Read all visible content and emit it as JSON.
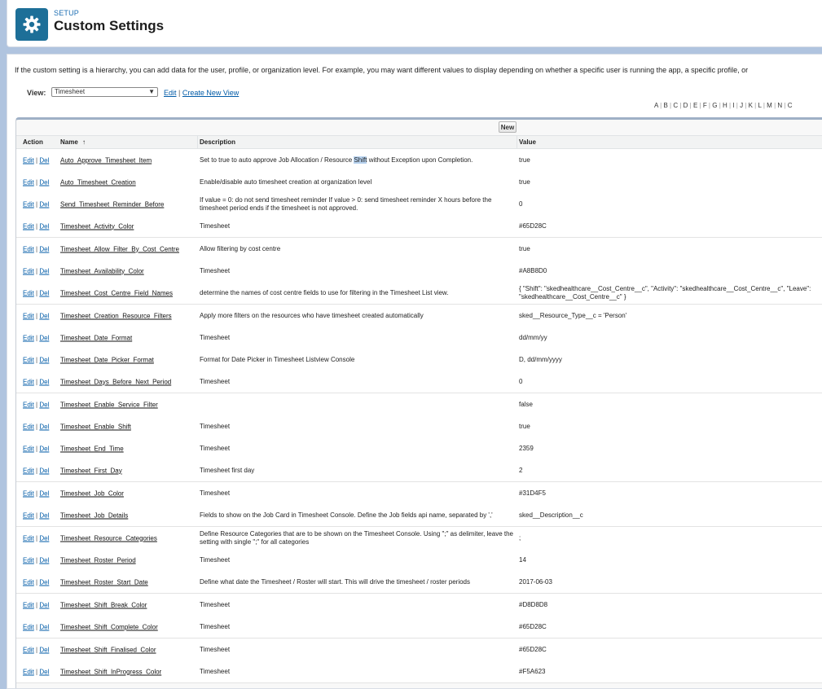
{
  "header": {
    "kicker": "SETUP",
    "title": "Custom Settings",
    "icon": "gear-icon"
  },
  "intro": "If the custom setting is a hierarchy, you can add data for the user, profile, or organization level. For example, you may want different values to display depending on whether a specific user is running the app, a specific profile, or",
  "view": {
    "label": "View:",
    "selected": "Timesheet",
    "edit_link": "Edit",
    "separator": "|",
    "create_link": "Create New View"
  },
  "alpha_filter": [
    "A",
    "B",
    "C",
    "D",
    "E",
    "F",
    "G",
    "H",
    "I",
    "J",
    "K",
    "L",
    "M",
    "N",
    "C"
  ],
  "table": {
    "new_button": "New",
    "columns": {
      "action": "Action",
      "name": "Name",
      "sort_indicator": "↑",
      "description": "Description",
      "value": "Value"
    },
    "action_edit": "Edit",
    "action_sep": "|",
    "action_del": "Del",
    "rows": [
      {
        "name": "Auto_Approve_Timesheet_Item",
        "desc_pre": "Set to true to auto approve Job Allocation / Resource ",
        "desc_hl": "Shift",
        "desc_post": " without Exception upon Completion.",
        "value": "true"
      },
      {
        "name": "Auto_Timesheet_Creation",
        "desc_pre": "Enable/disable auto timesheet creation at organization level",
        "desc_hl": "",
        "desc_post": "",
        "value": "true"
      },
      {
        "name": "Send_Timesheet_Reminder_Before",
        "desc_pre": "If value = 0: do not send timesheet reminder If value > 0: send timesheet reminder X hours before the timesheet period ends if the timesheet is not approved.",
        "desc_hl": "",
        "desc_post": "",
        "value": "0"
      },
      {
        "name": "Timesheet_Activity_Color",
        "desc_pre": "Timesheet",
        "desc_hl": "",
        "desc_post": "",
        "value": "#65D28C"
      },
      {
        "name": "Timesheet_Allow_Filter_By_Cost_Centre",
        "desc_pre": "Allow filtering by cost centre",
        "desc_hl": "",
        "desc_post": "",
        "value": "true"
      },
      {
        "name": "Timesheet_Availability_Color",
        "desc_pre": "Timesheet",
        "desc_hl": "",
        "desc_post": "",
        "value": "#A8B8D0"
      },
      {
        "name": "Timesheet_Cost_Centre_Field_Names",
        "desc_pre": "determine the names of cost centre fields to use for filtering in the Timesheet List view.",
        "desc_hl": "",
        "desc_post": "",
        "value": "{ \"Shift\": \"skedhealthcare__Cost_Centre__c\", \"Activity\": \"skedhealthcare__Cost_Centre__c\", \"Leave\": \"skedhealthcare__Cost_Centre__c\" }"
      },
      {
        "name": "Timesheet_Creation_Resource_Filters",
        "desc_pre": "Apply more filters on the resources who have timesheet created automatically",
        "desc_hl": "",
        "desc_post": "",
        "value": "sked__Resource_Type__c = 'Person'"
      },
      {
        "name": "Timesheet_Date_Format",
        "desc_pre": "Timesheet",
        "desc_hl": "",
        "desc_post": "",
        "value": "dd/mm/yy"
      },
      {
        "name": "Timesheet_Date_Picker_Format",
        "desc_pre": "Format for Date Picker in Timesheet Listview Console",
        "desc_hl": "",
        "desc_post": "",
        "value": "D, dd/mm/yyyy"
      },
      {
        "name": "Timesheet_Days_Before_Next_Period",
        "desc_pre": "Timesheet",
        "desc_hl": "",
        "desc_post": "",
        "value": "0"
      },
      {
        "name": "Timesheet_Enable_Service_Filter",
        "desc_pre": "",
        "desc_hl": "",
        "desc_post": "",
        "value": "false"
      },
      {
        "name": "Timesheet_Enable_Shift",
        "desc_pre": "Timesheet",
        "desc_hl": "",
        "desc_post": "",
        "value": "true"
      },
      {
        "name": "Timesheet_End_Time",
        "desc_pre": "Timesheet",
        "desc_hl": "",
        "desc_post": "",
        "value": "2359"
      },
      {
        "name": "Timesheet_First_Day",
        "desc_pre": "Timesheet first day",
        "desc_hl": "",
        "desc_post": "",
        "value": "2"
      },
      {
        "name": "Timesheet_Job_Color",
        "desc_pre": "Timesheet",
        "desc_hl": "",
        "desc_post": "",
        "value": "#31D4F5"
      },
      {
        "name": "Timesheet_Job_Details",
        "desc_pre": "Fields to show on the Job Card in Timesheet Console. Define the Job fields api name, separated by ','",
        "desc_hl": "",
        "desc_post": "",
        "value": "sked__Description__c"
      },
      {
        "name": "Timesheet_Resource_Categories",
        "desc_pre": "Define Resource Categories that are to be shown on the Timesheet Console. Using \";\" as delimiter, leave the setting with single \";\" for all categories",
        "desc_hl": "",
        "desc_post": "",
        "value": ";"
      },
      {
        "name": "Timesheet_Roster_Period",
        "desc_pre": "Timesheet",
        "desc_hl": "",
        "desc_post": "",
        "value": "14"
      },
      {
        "name": "Timesheet_Roster_Start_Date",
        "desc_pre": "Define what date the Timesheet / Roster will start. This will drive the timesheet / roster periods",
        "desc_hl": "",
        "desc_post": "",
        "value": "2017-06-03"
      },
      {
        "name": "Timesheet_Shift_Break_Color",
        "desc_pre": "Timesheet",
        "desc_hl": "",
        "desc_post": "",
        "value": "#D8D8D8"
      },
      {
        "name": "Timesheet_Shift_Complete_Color",
        "desc_pre": "Timesheet",
        "desc_hl": "",
        "desc_post": "",
        "value": "#65D28C"
      },
      {
        "name": "Timesheet_Shift_Finalised_Color",
        "desc_pre": "Timesheet",
        "desc_hl": "",
        "desc_post": "",
        "value": "#65D28C"
      },
      {
        "name": "Timesheet_Shift_InProgress_Color",
        "desc_pre": "Timesheet",
        "desc_hl": "",
        "desc_post": "",
        "value": "#F5A623"
      }
    ]
  }
}
